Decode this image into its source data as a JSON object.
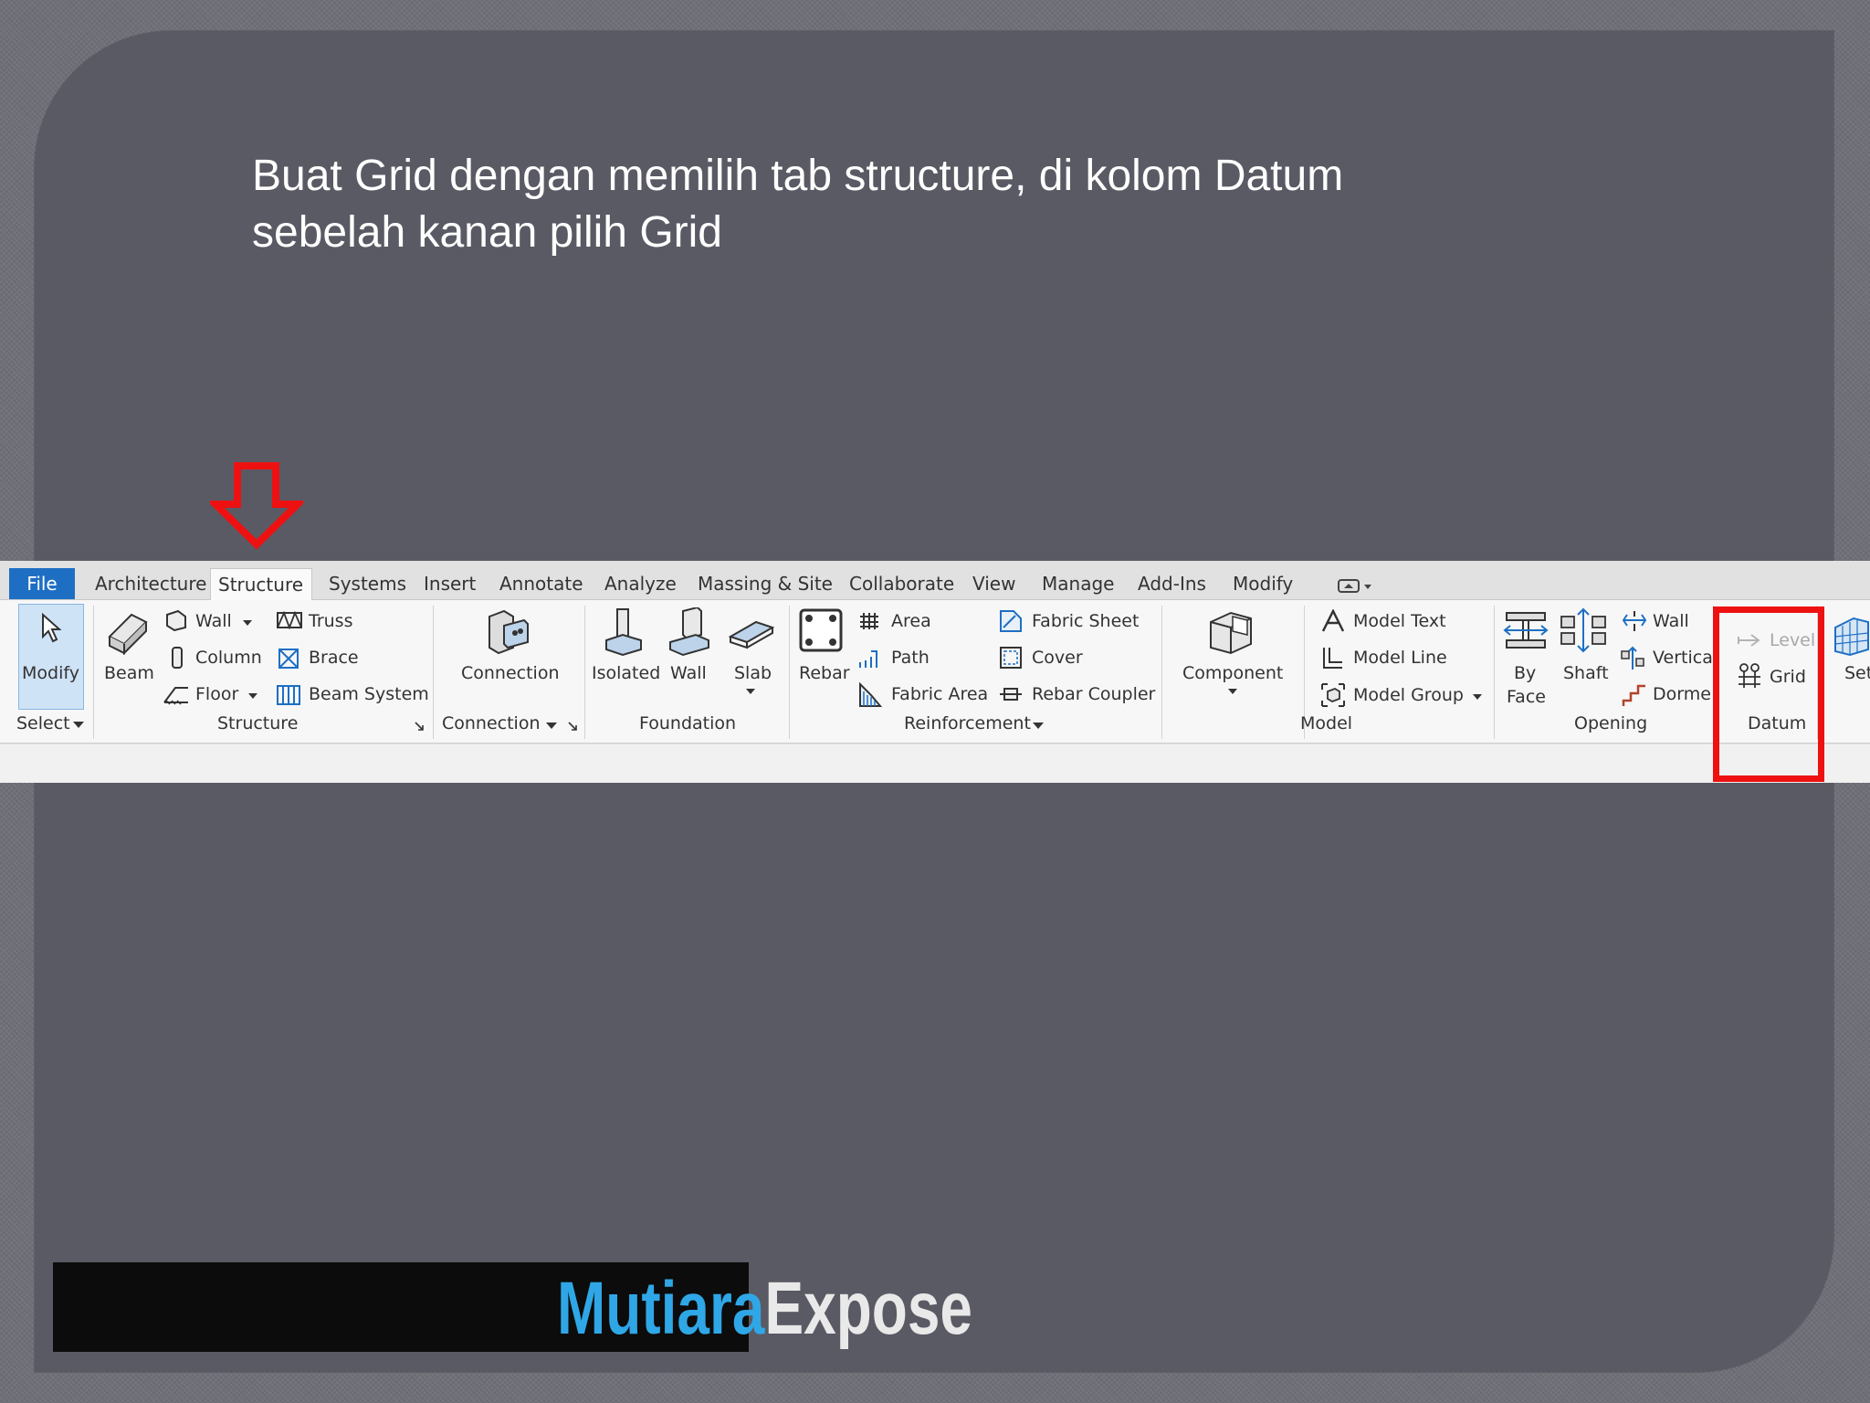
{
  "caption": {
    "line1": "Buat Grid dengan memilih tab structure, di kolom Datum",
    "line2": "sebelah kanan pilih Grid"
  },
  "tabs": [
    "File",
    "Architecture",
    "Structure",
    "Systems",
    "Insert",
    "Annotate",
    "Analyze",
    "Massing & Site",
    "Collaborate",
    "View",
    "Manage",
    "Add-Ins",
    "Modify"
  ],
  "active_tab": "Structure",
  "panels": {
    "select": {
      "title": "Select",
      "modify": "Modify"
    },
    "structure": {
      "title": "Structure",
      "beam": "Beam",
      "wall": "Wall",
      "column": "Column",
      "floor": "Floor",
      "truss": "Truss",
      "brace": "Brace",
      "beam_system": "Beam System"
    },
    "connection": {
      "title": "Connection",
      "connection": "Connection"
    },
    "foundation": {
      "title": "Foundation",
      "isolated": "Isolated",
      "wall": "Wall",
      "slab": "Slab"
    },
    "reinforcement": {
      "title": "Reinforcement",
      "rebar": "Rebar",
      "area": "Area",
      "path": "Path",
      "fabric_area": "Fabric Area",
      "fabric_sheet": "Fabric Sheet",
      "cover": "Cover",
      "rebar_coupler": "Rebar Coupler"
    },
    "model": {
      "title": "Model",
      "component": "Component",
      "model_text": "Model Text",
      "model_line": "Model Line",
      "model_group": "Model Group"
    },
    "opening": {
      "title": "Opening",
      "by": "By",
      "face": "Face",
      "shaft": "Shaft",
      "wall": "Wall",
      "vertical": "Vertica",
      "dormer": "Dorme"
    },
    "datum": {
      "title": "Datum",
      "level": "Level",
      "grid": "Grid"
    },
    "set": {
      "set": "Set"
    }
  },
  "brand": {
    "part1": "Mutiara",
    "part2": "Expose"
  },
  "colors": {
    "accent_red": "#ee1111",
    "file_tab": "#1e6fc4",
    "brand_blue": "#2fa7e6"
  }
}
